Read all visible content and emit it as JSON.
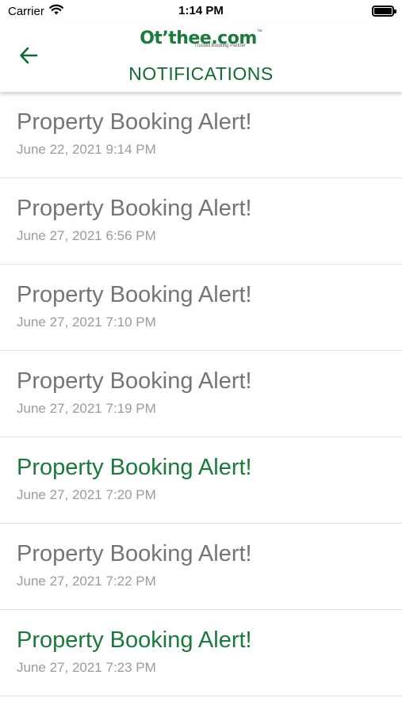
{
  "status_bar": {
    "carrier": "Carrier",
    "time": "1:14 PM",
    "wifi_icon": "wifi-icon",
    "battery_icon": "battery-icon",
    "battery_level": 1.0
  },
  "header": {
    "back_icon": "arrow-left-icon",
    "logo": {
      "text": "Ot’thee.com",
      "trademark": "™",
      "tagline": "Trusted Booking Partner"
    },
    "title": "NOTIFICATIONS"
  },
  "notifications": [
    {
      "title": "Property Booking Alert!",
      "date": "June 22, 2021 9:14 PM",
      "unread": false
    },
    {
      "title": "Property Booking Alert!",
      "date": "June 27, 2021 6:56 PM",
      "unread": false
    },
    {
      "title": "Property Booking Alert!",
      "date": "June 27, 2021 7:10 PM",
      "unread": false
    },
    {
      "title": "Property Booking Alert!",
      "date": "June 27, 2021 7:19 PM",
      "unread": false
    },
    {
      "title": "Property Booking Alert!",
      "date": "June 27, 2021 7:20 PM",
      "unread": true
    },
    {
      "title": "Property Booking Alert!",
      "date": "June 27, 2021 7:22 PM",
      "unread": false
    },
    {
      "title": "Property Booking Alert!",
      "date": "June 27, 2021 7:23 PM",
      "unread": true
    }
  ],
  "colors": {
    "brand_green": "#1a7a3c",
    "read_text": "#757575",
    "date_text": "#9b9b9b"
  }
}
